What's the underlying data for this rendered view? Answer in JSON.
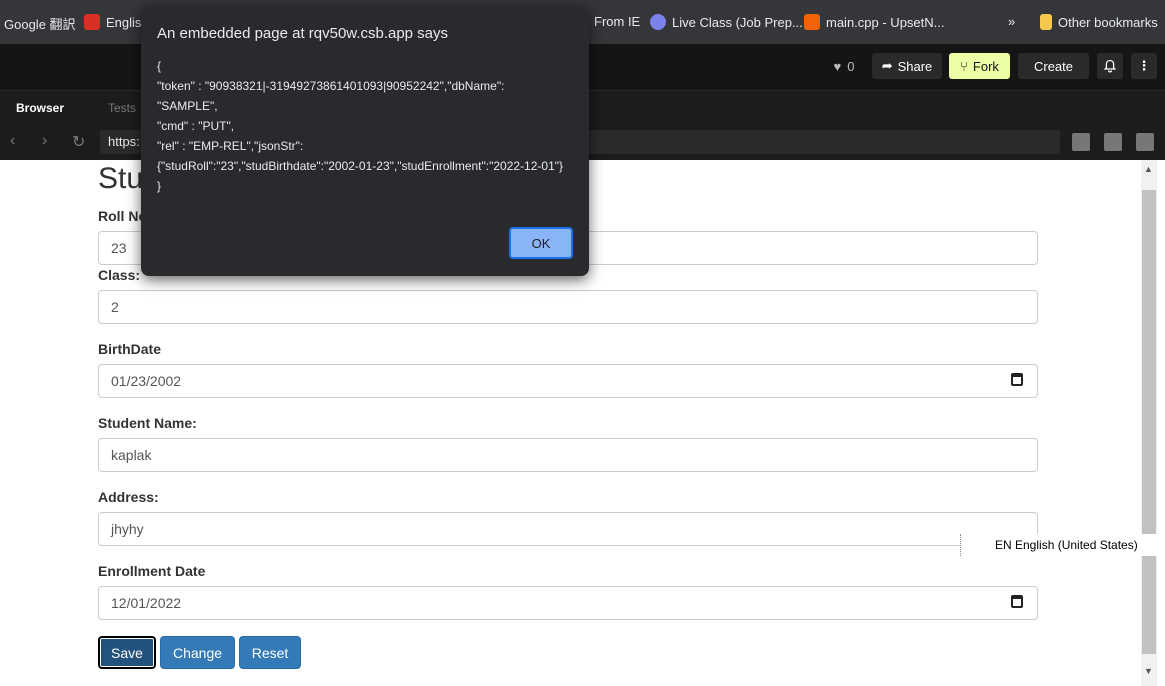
{
  "bookmarks": [
    {
      "label": "Google 翻訳",
      "color": "#4285f4"
    },
    {
      "label": "Englis",
      "color": "#d93025"
    },
    {
      "label": "From IE",
      "color": "#35363a"
    },
    {
      "label": "Live Class (Job Prep...",
      "color": "#7b83eb"
    },
    {
      "label": "main.cpp - UpsetN...",
      "color": "#f26207"
    },
    {
      "label": "Other bookmarks",
      "color": "#f8c84e"
    }
  ],
  "bookmarks_overflow": "»",
  "header": {
    "likes_count": "0",
    "share_label": "Share",
    "fork_label": "Fork",
    "create_label": "Create",
    "more_glyph": "⋮"
  },
  "tabs": {
    "browser": "Browser",
    "tests": "Tests"
  },
  "address": {
    "url": "https:"
  },
  "page": {
    "title": "Stu",
    "fields": [
      {
        "label": "Roll No",
        "value": "23"
      },
      {
        "label": "Class:",
        "value": "2"
      },
      {
        "label": "BirthDate",
        "value": "01/23/2002"
      },
      {
        "label": "Student Name:",
        "value": "kaplak"
      },
      {
        "label": "Address:",
        "value": "jhyhy"
      },
      {
        "label": "Enrollment Date",
        "value": "12/01/2022"
      }
    ],
    "buttons": {
      "save": "Save",
      "change": "Change",
      "reset": "Reset"
    }
  },
  "language_bar": {
    "text": "EN English (United States)"
  },
  "dialog": {
    "title": "An embedded page at rqv50w.csb.app says",
    "message": "{\n\"token\" : \"90938321|-31949273861401093|90952242\",\"dbName\":\n\"SAMPLE\",\n\"cmd\" : \"PUT\",\n\"rel\" : \"EMP-REL\",\"jsonStr\":\n{\"studRoll\":\"23\",\"studBirthdate\":\"2002-01-23\",\"studEnrollment\":\"2022-12-01\"}\n}",
    "ok_label": "OK"
  },
  "colors": {
    "accent": "#337ab7",
    "dialog_bg": "#292a2d",
    "fork": "#edffa5"
  }
}
